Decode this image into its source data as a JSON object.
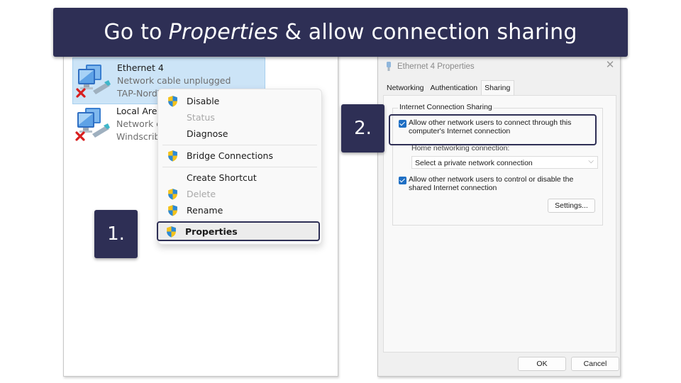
{
  "banner": {
    "prefix": "Go to",
    "emphasis": "Properties",
    "suffix": "& allow connection sharing"
  },
  "steps": [
    "1.",
    "2."
  ],
  "colors": {
    "banner_bg": "#2e2f55",
    "selection": "#cce4f7",
    "checkbox": "#1f6fc4"
  },
  "network_connections": {
    "adapters": [
      {
        "name": "Ethernet 4",
        "status": "Network cable unplugged",
        "device": "TAP-NordVPN",
        "selected": true,
        "icon": "network-adapter-disconnected-icon"
      },
      {
        "name": "Local Area Connection",
        "status": "Network cable unplugged",
        "device": "Windscribe",
        "selected": false,
        "icon": "network-adapter-disconnected-icon"
      }
    ],
    "context_menu": {
      "items": [
        {
          "label": "Disable",
          "shield": true,
          "disabled": false
        },
        {
          "label": "Status",
          "shield": false,
          "disabled": true
        },
        {
          "label": "Diagnose",
          "shield": false,
          "disabled": false
        },
        {
          "label": "Bridge Connections",
          "shield": true,
          "disabled": false
        },
        {
          "label": "Create Shortcut",
          "shield": false,
          "disabled": false
        },
        {
          "label": "Delete",
          "shield": true,
          "disabled": true
        },
        {
          "label": "Rename",
          "shield": true,
          "disabled": false
        },
        {
          "label": "Properties",
          "shield": true,
          "disabled": false,
          "highlighted": true
        }
      ]
    }
  },
  "properties_dialog": {
    "title": "Ethernet 4 Properties",
    "tabs": [
      {
        "label": "Networking",
        "active": false
      },
      {
        "label": "Authentication",
        "active": false
      },
      {
        "label": "Sharing",
        "active": true
      }
    ],
    "group_label": "Internet Connection Sharing",
    "allow_connect": {
      "checked": true,
      "line1": "Allow other network users to connect through this",
      "line2": "computer's Internet connection"
    },
    "home_networking_label": "Home networking connection:",
    "home_networking_select": "Select a private network connection",
    "allow_control": {
      "checked": true,
      "line1": "Allow other network users to control or disable the",
      "line2": "shared Internet connection"
    },
    "settings_button": "Settings...",
    "ok_button": "OK",
    "cancel_button": "Cancel",
    "close_glyph": "✕",
    "chevron_glyph": "⌵"
  }
}
